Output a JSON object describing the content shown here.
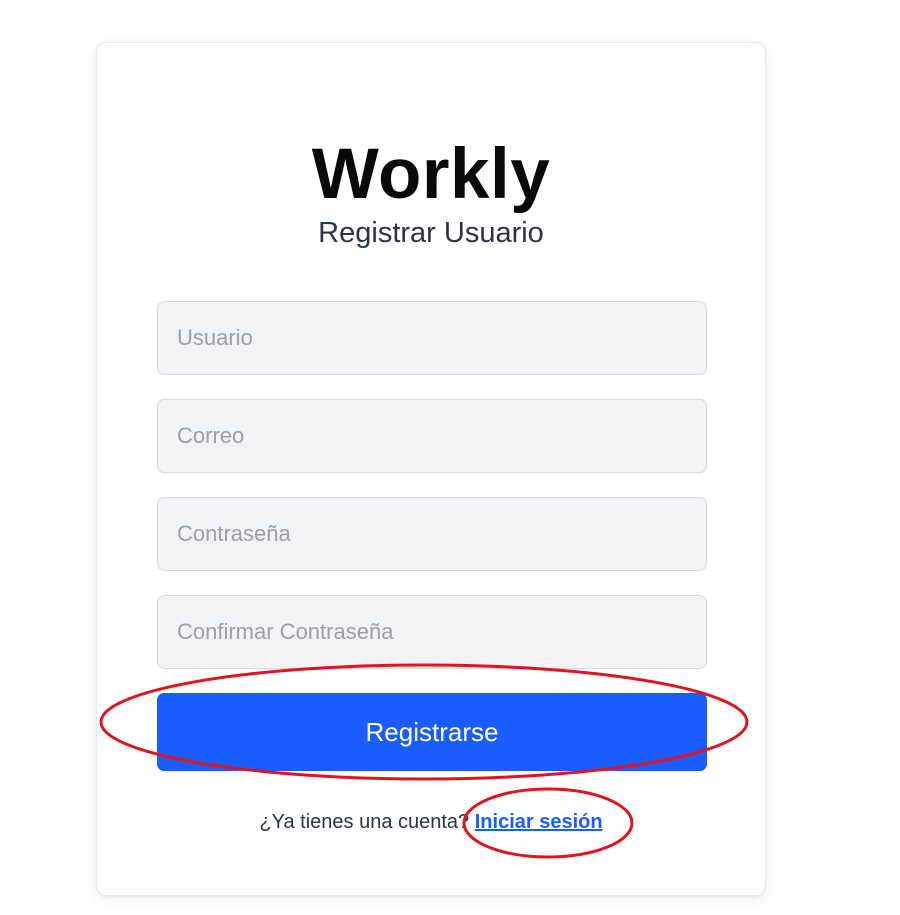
{
  "app": {
    "brand": "Workly",
    "subtitle": "Registrar Usuario"
  },
  "form": {
    "username_placeholder": "Usuario",
    "email_placeholder": "Correo",
    "password_placeholder": "Contraseña",
    "confirm_password_placeholder": "Confirmar Contraseña",
    "submit_label": "Registrarse"
  },
  "footer": {
    "prompt": "¿Ya tienes una cuenta? ",
    "login_link": "Iniciar sesión"
  },
  "colors": {
    "accent": "#1a5cff",
    "annotation": "#e0141e",
    "field_background": "#f2f3f5"
  }
}
